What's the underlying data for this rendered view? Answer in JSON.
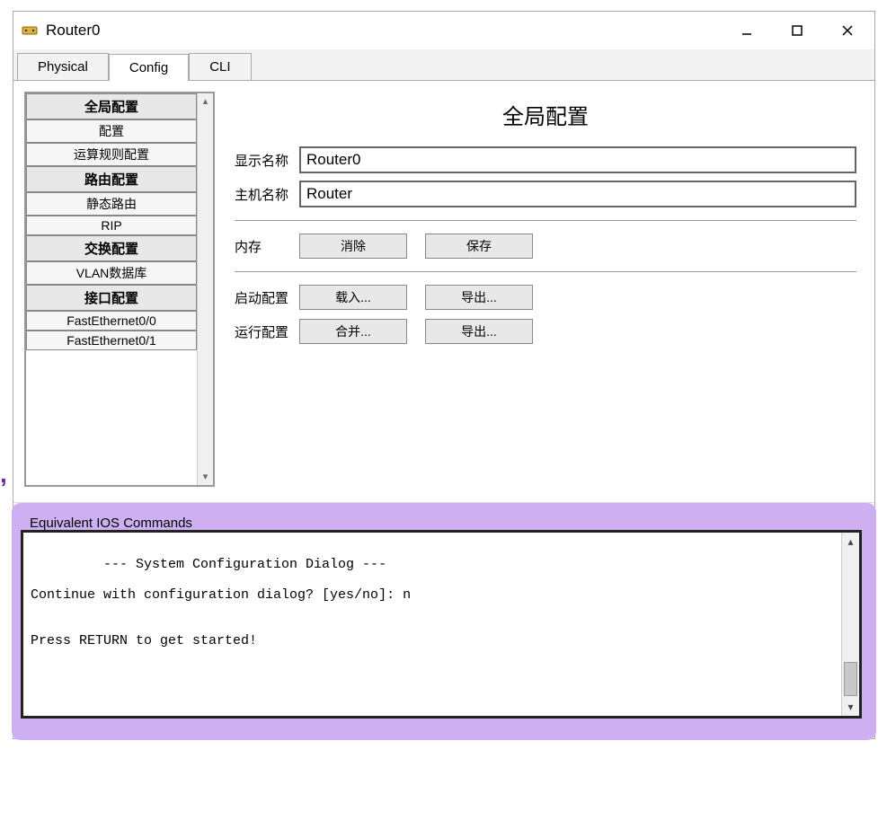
{
  "window": {
    "title": "Router0"
  },
  "tabs": {
    "physical": "Physical",
    "config": "Config",
    "cli": "CLI"
  },
  "sidebar": {
    "sections": [
      {
        "header": "全局配置",
        "items": [
          "配置",
          "运算规则配置"
        ]
      },
      {
        "header": "路由配置",
        "items": [
          "静态路由",
          "RIP"
        ]
      },
      {
        "header": "交换配置",
        "items": [
          "VLAN数据库"
        ]
      },
      {
        "header": "接口配置",
        "items": [
          "FastEthernet0/0",
          "FastEthernet0/1"
        ]
      }
    ]
  },
  "main": {
    "heading": "全局配置",
    "display_name_label": "显示名称",
    "display_name_value": "Router0",
    "host_name_label": "主机名称",
    "host_name_value": "Router",
    "memory_label": "内存",
    "memory_btn_clear": "消除",
    "memory_btn_save": "保存",
    "startup_label": "启动配置",
    "startup_btn_load": "载入...",
    "startup_btn_export": "导出...",
    "running_label": "运行配置",
    "running_btn_merge": "合并...",
    "running_btn_export": "导出..."
  },
  "ios": {
    "legend": "Equivalent IOS Commands",
    "content": "\n         --- System Configuration Dialog ---\n\nContinue with configuration dialog? [yes/no]: n\n\n\nPress RETURN to get started!"
  }
}
